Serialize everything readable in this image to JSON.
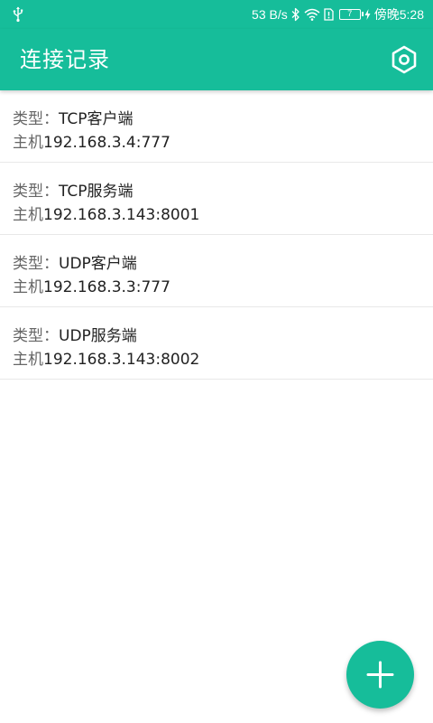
{
  "status_bar": {
    "speed": "53 B/s",
    "battery_level": "7",
    "time": "傍晚5:28"
  },
  "app_bar": {
    "title": "连接记录",
    "settings_icon": "hexagon-gear-icon"
  },
  "records": [
    {
      "type_label": "类型：",
      "type_value": "TCP客户端",
      "host_label": "主机",
      "host_value": "192.168.3.4:777"
    },
    {
      "type_label": "类型：",
      "type_value": "TCP服务端",
      "host_label": "主机",
      "host_value": "192.168.3.143:8001"
    },
    {
      "type_label": "类型：",
      "type_value": "UDP客户端",
      "host_label": "主机",
      "host_value": "192.168.3.3:777"
    },
    {
      "type_label": "类型：",
      "type_value": "UDP服务端",
      "host_label": "主机",
      "host_value": "192.168.3.143:8002"
    }
  ],
  "fab": {
    "icon": "plus-icon"
  },
  "colors": {
    "accent": "#16bd9a",
    "text_primary": "#222222",
    "text_label": "#666666",
    "divider": "#e8e8e8"
  }
}
